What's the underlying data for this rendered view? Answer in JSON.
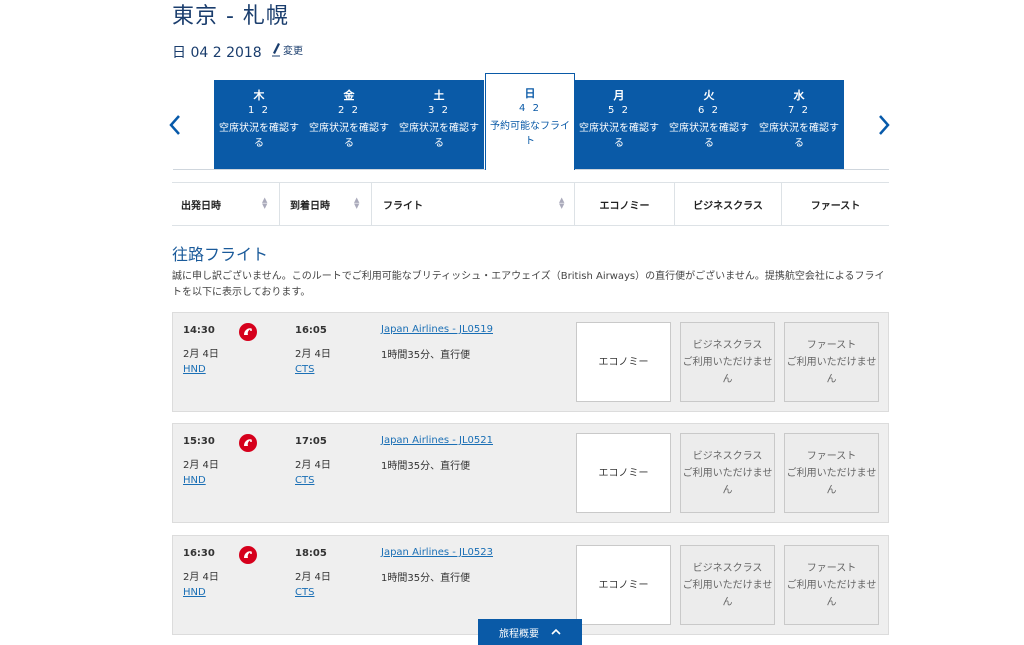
{
  "header": {
    "route": "東京 - 札幌",
    "date": "日 04 2 2018",
    "change_label": "変更"
  },
  "week": [
    {
      "dow": "木",
      "date": "1 2",
      "status": "空席状況を確認する",
      "selected": false
    },
    {
      "dow": "金",
      "date": "2 2",
      "status": "空席状況を確認する",
      "selected": false
    },
    {
      "dow": "土",
      "date": "3 2",
      "status": "空席状況を確認する",
      "selected": false
    },
    {
      "dow": "日",
      "date": "4 2",
      "status": "予約可能なフライト",
      "selected": true
    },
    {
      "dow": "月",
      "date": "5 2",
      "status": "空席状況を確認する",
      "selected": false
    },
    {
      "dow": "火",
      "date": "6 2",
      "status": "空席状況を確認する",
      "selected": false
    },
    {
      "dow": "水",
      "date": "7 2",
      "status": "空席状況を確認する",
      "selected": false
    }
  ],
  "columns": {
    "departure": "出発日時",
    "arrival": "到着日時",
    "flight": "フライト",
    "economy": "エコノミー",
    "business": "ビジネスクラス",
    "first": "ファースト"
  },
  "section_title": "往路フライト",
  "notice": "誠に申し訳ございません。このルートでご利用可能なブリティッシュ・エアウェイズ（British Airways）の直行便がございません。提携航空会社によるフライトを以下に表示しております。",
  "fare_labels": {
    "economy": "エコノミー",
    "business": "ビジネスクラス",
    "first": "ファースト",
    "unavailable": "ご利用いただけません"
  },
  "flights": [
    {
      "dep_time": "14:30",
      "dep_date": "2月 4日",
      "dep_airport": "HND",
      "arr_time": "16:05",
      "arr_date": "2月 4日",
      "arr_airport": "CTS",
      "flight": "Japan Airlines - JL0519",
      "duration": "1時間35分、直行便"
    },
    {
      "dep_time": "15:30",
      "dep_date": "2月 4日",
      "dep_airport": "HND",
      "arr_time": "17:05",
      "arr_date": "2月 4日",
      "arr_airport": "CTS",
      "flight": "Japan Airlines - JL0521",
      "duration": "1時間35分、直行便"
    },
    {
      "dep_time": "16:30",
      "dep_date": "2月 4日",
      "dep_airport": "HND",
      "arr_time": "18:05",
      "arr_date": "2月 4日",
      "arr_airport": "CTS",
      "flight": "Japan Airlines - JL0523",
      "duration": "1時間35分、直行便"
    }
  ],
  "summary_label": "旅程概要",
  "colors": {
    "brand_blue": "#0a5aa7",
    "jal_red": "#d6001c"
  }
}
